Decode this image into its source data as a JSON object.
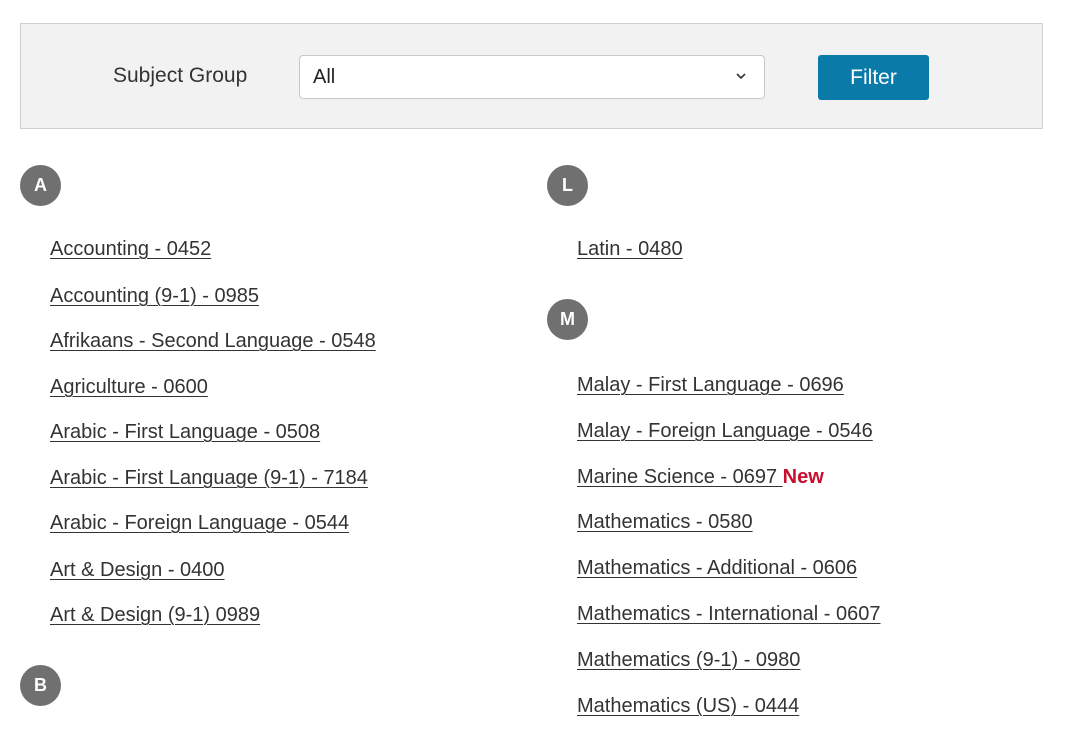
{
  "filter": {
    "label": "Subject Group",
    "select_value": "All",
    "button_label": "Filter"
  },
  "columns": [
    {
      "sections": [
        {
          "letter": "A",
          "subjects": [
            "Accounting - 0452",
            "Accounting (9-1) - 0985",
            "Afrikaans - Second Language - 0548",
            "Agriculture - 0600",
            "Arabic - First Language - 0508",
            "Arabic - First Language (9-1) - 7184",
            "Arabic - Foreign Language - 0544",
            "Art & Design - 0400",
            "Art & Design (9-1) 0989"
          ]
        },
        {
          "letter": "B",
          "subjects": []
        }
      ]
    },
    {
      "sections": [
        {
          "letter": "L",
          "subjects": [
            "Latin - 0480"
          ]
        },
        {
          "letter": "M",
          "subjects": [
            "Malay - First Language - 0696",
            "Malay - Foreign Language - 0546",
            "Marine Science - 0697 ",
            "Mathematics - 0580",
            "Mathematics - Additional - 0606",
            "Mathematics - International - 0607",
            "Mathematics (9-1) - 0980",
            "Mathematics (US) - 0444"
          ]
        }
      ]
    }
  ],
  "new_label": "New",
  "colors": {
    "accent": "#0a7aa9",
    "badge": "#707070",
    "new": "#c8102e"
  }
}
